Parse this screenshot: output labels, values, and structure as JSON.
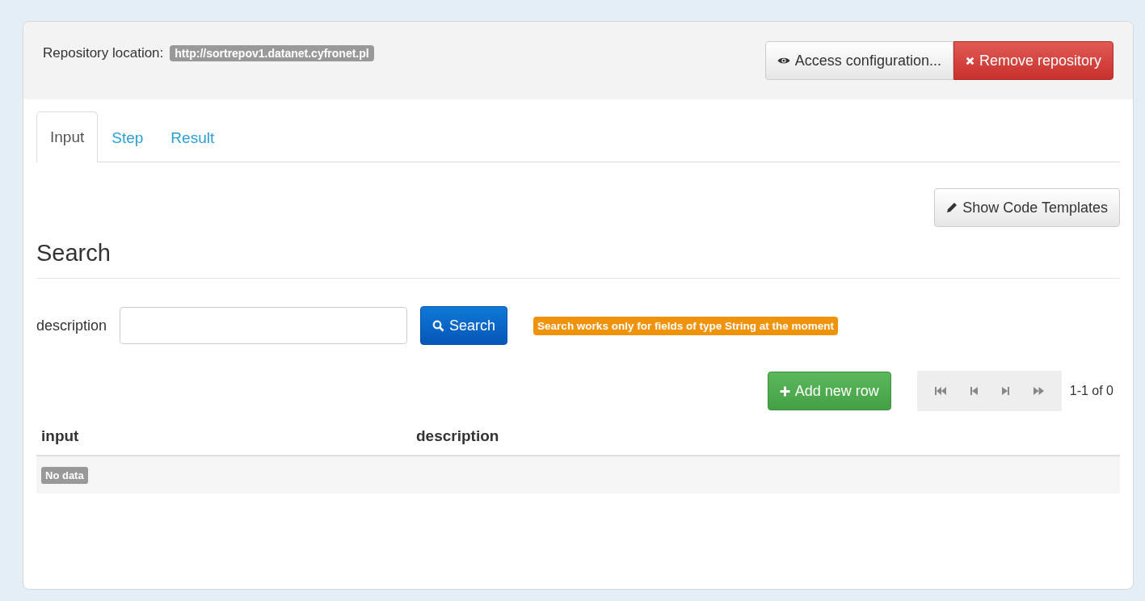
{
  "header": {
    "label": "Repository location:",
    "url": "http://sortrepov1.datanet.cyfronet.pl",
    "buttons": [
      {
        "label": "Access configuration...",
        "kind": "default"
      },
      {
        "label": "Remove repository",
        "kind": "danger"
      }
    ]
  },
  "tabs": [
    {
      "label": "Input",
      "selected": true
    },
    {
      "label": "Step",
      "selected": false
    },
    {
      "label": "Result",
      "selected": false
    }
  ],
  "templates_button": "Show Code Templates",
  "section_title": "Search",
  "search": {
    "label": "description",
    "button": "Search",
    "note": "Search works only for fields of type String at the moment"
  },
  "add_button": "Add new row",
  "pager": {
    "status": "1-1 of 0"
  },
  "table": {
    "columns": [
      "input",
      "description"
    ],
    "empty": "No data"
  }
}
